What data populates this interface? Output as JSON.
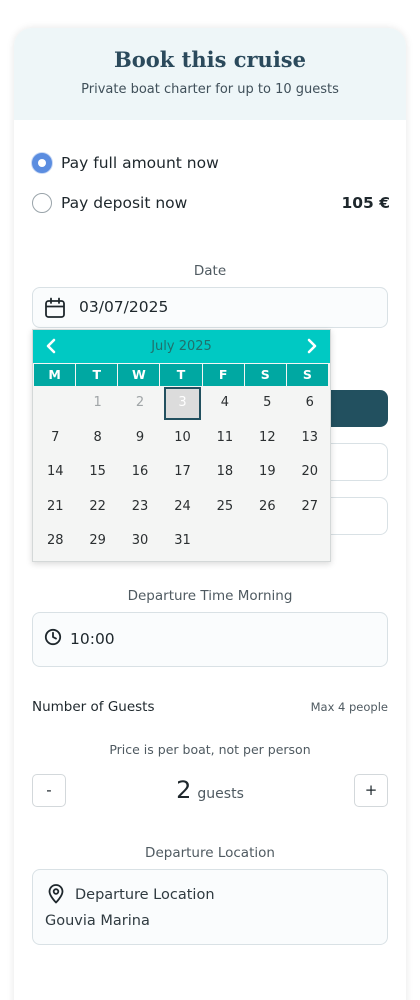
{
  "header": {
    "title": "Book this cruise",
    "subtitle": "Private boat charter for up to 10 guests"
  },
  "payment": {
    "options": [
      {
        "label": "Pay full amount now",
        "checked": true
      },
      {
        "label": "Pay deposit now",
        "checked": false,
        "price": "105 €"
      }
    ]
  },
  "date": {
    "label": "Date",
    "value": "03/07/2025",
    "icon": "calendar-icon"
  },
  "calendar": {
    "month_label": "July 2025",
    "prev_icon": "chevron-left-icon",
    "next_icon": "chevron-right-icon",
    "weekdays": [
      "M",
      "T",
      "W",
      "T",
      "F",
      "S",
      "S"
    ],
    "weeks": [
      [
        "",
        "1",
        "2",
        "3",
        "4",
        "5",
        "6"
      ],
      [
        "7",
        "8",
        "9",
        "10",
        "11",
        "12",
        "13"
      ],
      [
        "14",
        "15",
        "16",
        "17",
        "18",
        "19",
        "20"
      ],
      [
        "21",
        "22",
        "23",
        "24",
        "25",
        "26",
        "27"
      ],
      [
        "28",
        "29",
        "30",
        "31",
        "",
        "",
        ""
      ]
    ],
    "disabled_days": [
      "1",
      "2"
    ],
    "selected_day": "3",
    "colors": {
      "header": "#00c9c3",
      "weekday": "#00a8a2",
      "selected_border": "#22505f"
    }
  },
  "departure_time": {
    "label": "Departure Time Morning",
    "value": "10:00",
    "icon": "clock-icon"
  },
  "guests": {
    "title": "Number of Guests",
    "max_note": "Max 4 people",
    "price_note": "Price is per boat, not per person",
    "minus_label": "-",
    "plus_label": "+",
    "count": "2",
    "unit": "guests"
  },
  "location": {
    "label": "Departure Location",
    "field_title": "Departure Location",
    "value": "Gouvia Marina",
    "icon": "map-pin-icon"
  },
  "colors": {
    "brand_dark": "#22505f",
    "radio_accent": "#5b8de0",
    "header_bg": "#eef6f8"
  }
}
